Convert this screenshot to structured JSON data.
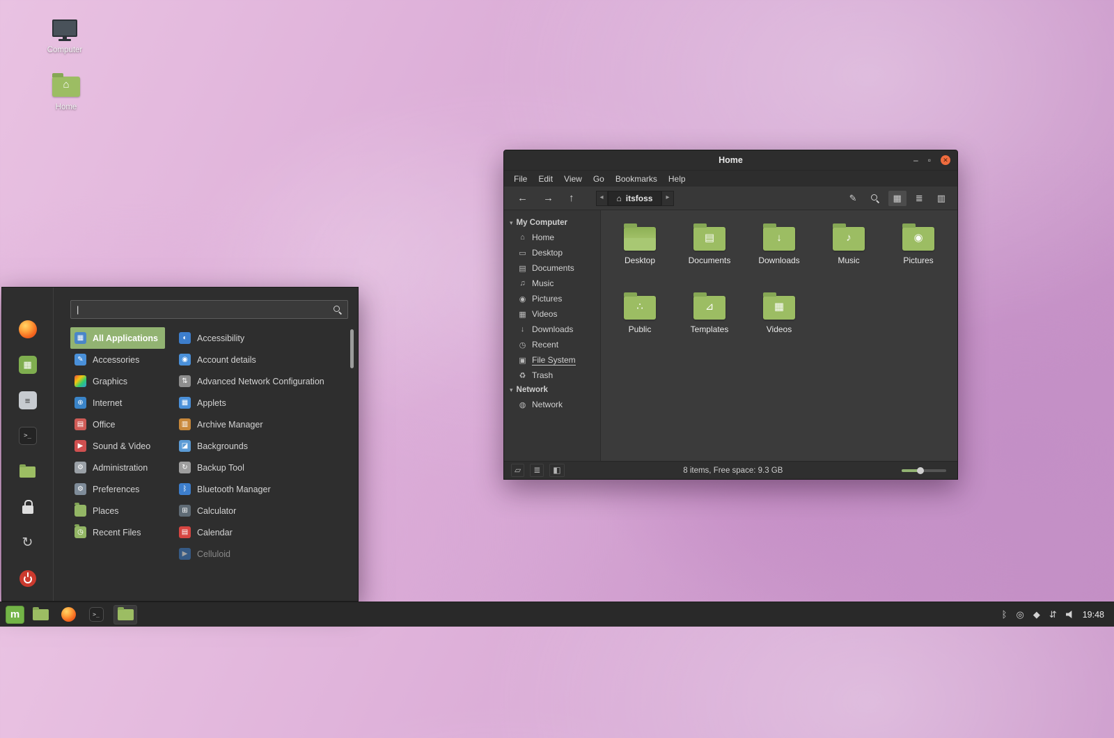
{
  "desktop": {
    "icons": [
      {
        "label": "Computer",
        "icon": "computer-icon"
      },
      {
        "label": "Home",
        "icon": "home-folder-icon"
      }
    ]
  },
  "file_manager": {
    "title": "Home",
    "menubar": [
      "File",
      "Edit",
      "View",
      "Go",
      "Bookmarks",
      "Help"
    ],
    "toolbar": {
      "breadcrumb": "itsfoss"
    },
    "sidebar": [
      {
        "title": "My Computer",
        "items": [
          {
            "label": "Home",
            "icon": "home-icon"
          },
          {
            "label": "Desktop",
            "icon": "desktop-icon"
          },
          {
            "label": "Documents",
            "icon": "documents-icon"
          },
          {
            "label": "Music",
            "icon": "music-icon"
          },
          {
            "label": "Pictures",
            "icon": "pictures-icon"
          },
          {
            "label": "Videos",
            "icon": "videos-icon"
          },
          {
            "label": "Downloads",
            "icon": "downloads-icon"
          },
          {
            "label": "Recent",
            "icon": "recent-icon"
          },
          {
            "label": "File System",
            "icon": "filesystem-icon",
            "underline": true
          },
          {
            "label": "Trash",
            "icon": "trash-icon"
          }
        ]
      },
      {
        "title": "Network",
        "items": [
          {
            "label": "Network",
            "icon": "network-icon"
          }
        ]
      }
    ],
    "folders": [
      {
        "label": "Desktop",
        "emblem": "none"
      },
      {
        "label": "Documents",
        "emblem": "document"
      },
      {
        "label": "Downloads",
        "emblem": "download"
      },
      {
        "label": "Music",
        "emblem": "music"
      },
      {
        "label": "Pictures",
        "emblem": "picture"
      },
      {
        "label": "Public",
        "emblem": "share"
      },
      {
        "label": "Templates",
        "emblem": "template"
      },
      {
        "label": "Videos",
        "emblem": "video"
      }
    ],
    "statusbar": {
      "text": "8 items, Free space: 9.3 GB"
    }
  },
  "menu": {
    "search_placeholder": "",
    "categories": [
      {
        "label": "All Applications",
        "icon": "all-applications-icon",
        "selected": true
      },
      {
        "label": "Accessories",
        "icon": "accessories-icon"
      },
      {
        "label": "Graphics",
        "icon": "graphics-icon"
      },
      {
        "label": "Internet",
        "icon": "internet-icon"
      },
      {
        "label": "Office",
        "icon": "office-icon"
      },
      {
        "label": "Sound & Video",
        "icon": "sound-video-icon"
      },
      {
        "label": "Administration",
        "icon": "administration-icon"
      },
      {
        "label": "Preferences",
        "icon": "preferences-icon"
      },
      {
        "label": "Places",
        "icon": "places-icon"
      },
      {
        "label": "Recent Files",
        "icon": "recent-files-icon"
      }
    ],
    "apps": [
      {
        "label": "Accessibility",
        "icon": "accessibility-icon"
      },
      {
        "label": "Account details",
        "icon": "account-details-icon"
      },
      {
        "label": "Advanced Network Configuration",
        "icon": "network-config-icon"
      },
      {
        "label": "Applets",
        "icon": "applets-icon"
      },
      {
        "label": "Archive Manager",
        "icon": "archive-manager-icon"
      },
      {
        "label": "Backgrounds",
        "icon": "backgrounds-icon"
      },
      {
        "label": "Backup Tool",
        "icon": "backup-tool-icon"
      },
      {
        "label": "Bluetooth Manager",
        "icon": "bluetooth-manager-icon"
      },
      {
        "label": "Calculator",
        "icon": "calculator-icon"
      },
      {
        "label": "Calendar",
        "icon": "calendar-icon"
      },
      {
        "label": "Celluloid",
        "icon": "celluloid-icon",
        "dimmed": true
      }
    ],
    "rail": [
      "firefox",
      "software-manager",
      "system-settings",
      "terminal",
      "files",
      "lock-screen",
      "logout",
      "quit"
    ]
  },
  "panel": {
    "launchers": [
      "files",
      "firefox",
      "terminal"
    ],
    "window_button": "files-window",
    "tray": [
      "bluetooth",
      "blueman",
      "firewall",
      "network",
      "volume"
    ],
    "clock": "19:48"
  },
  "colors": {
    "accent": "#92b372",
    "folder_green": "#9cbd63",
    "close_button": "#ef6c3e"
  }
}
